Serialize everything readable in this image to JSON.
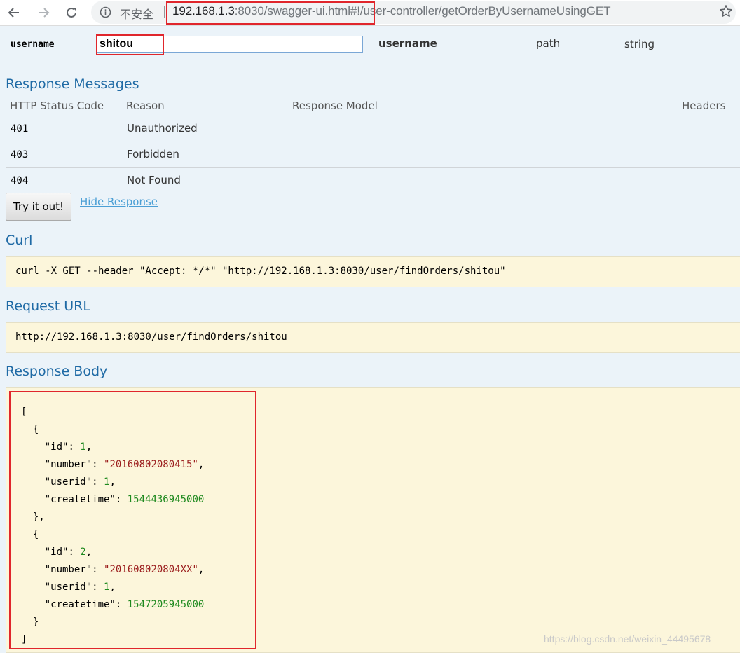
{
  "browser": {
    "security_label": "不安全",
    "separator": "|",
    "url_host": "192.168.1.3",
    "url_rest": ":8030/swagger-ui.html#!/user-controller/getOrderByUsernameUsingGET",
    "icons": {
      "back": "back-arrow-icon",
      "forward": "forward-arrow-icon",
      "reload": "reload-icon",
      "info": "info-icon",
      "bookmark": "star-icon"
    }
  },
  "parameter": {
    "name": "username",
    "value": "shitou",
    "description": "username",
    "param_type": "path",
    "data_type": "string"
  },
  "response_messages": {
    "title": "Response Messages",
    "headers": [
      "HTTP Status Code",
      "Reason",
      "Response Model",
      "Headers"
    ],
    "rows": [
      {
        "code": "401",
        "reason": "Unauthorized"
      },
      {
        "code": "403",
        "reason": "Forbidden"
      },
      {
        "code": "404",
        "reason": "Not Found"
      }
    ]
  },
  "actions": {
    "try_label": "Try it out!",
    "hide_label": "Hide Response"
  },
  "curl": {
    "title": "Curl",
    "command": "curl -X GET --header \"Accept: */*\" \"http://192.168.1.3:8030/user/findOrders/shitou\""
  },
  "request_url": {
    "title": "Request URL",
    "value": "http://192.168.1.3:8030/user/findOrders/shitou"
  },
  "response_body": {
    "title": "Response Body",
    "items": [
      {
        "id": "1",
        "number": "20160802080415",
        "userid": "1",
        "createtime": "1544436945000"
      },
      {
        "id": "2",
        "number": "201608020804XX",
        "userid": "1",
        "createtime": "1547205945000"
      }
    ]
  },
  "watermark": "https://blog.csdn.net/weixin_44495678",
  "colors": {
    "heading": "#1f6aa5",
    "highlight": "#e0262c",
    "code_bg": "#fcf6db",
    "page_bg": "#ebf3f9"
  }
}
